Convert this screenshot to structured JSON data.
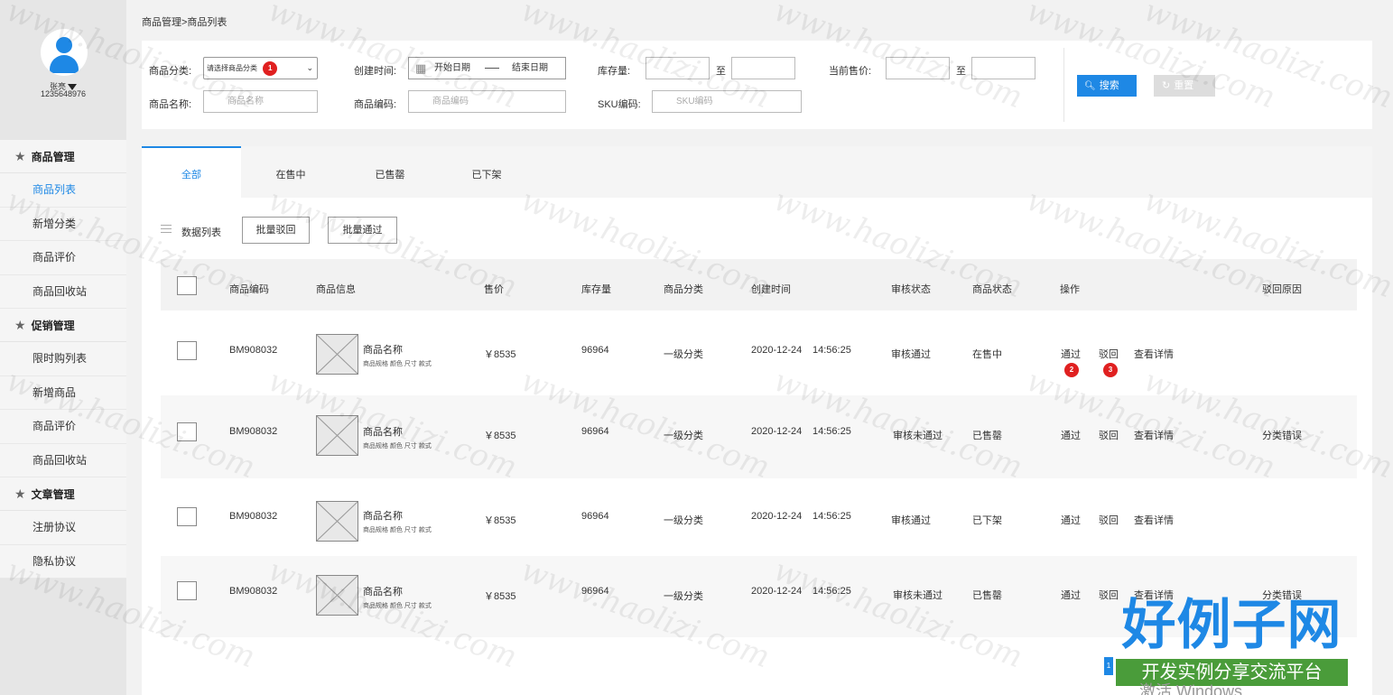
{
  "sidebar": {
    "user_name": "张亮",
    "user_id": "1235648976",
    "groups": [
      {
        "title": "商品管理",
        "items": [
          "商品列表",
          "新增分类",
          "商品评价",
          "商品回收站"
        ]
      },
      {
        "title": "促销管理",
        "items": [
          "限时购列表",
          "新增商品",
          "商品评价",
          "商品回收站"
        ]
      },
      {
        "title": "文章管理",
        "items": [
          "注册协议",
          "隐私协议"
        ]
      }
    ]
  },
  "breadcrumb": "商品管理>商品列表",
  "filters": {
    "category_label": "商品分类:",
    "category_value": "请选择商品分类",
    "category_badge": "1",
    "created_label": "创建时间:",
    "start_date": "开始日期",
    "end_date": "结束日期",
    "stock_label": "库存量:",
    "to": "至",
    "price_label": "当前售价:",
    "name_label": "商品名称:",
    "name_placeholder": "商品名称",
    "code_label": "商品编码:",
    "code_placeholder": "商品编码",
    "sku_label": "SKU编码:",
    "sku_placeholder": "SKU编码",
    "search_btn": "搜索",
    "reset_btn": "重置"
  },
  "tabs": [
    "全部",
    "在售中",
    "已售罄",
    "已下架"
  ],
  "list_title": "数据列表",
  "batch_reject": "批量驳回",
  "batch_pass": "批量通过",
  "columns": [
    "商品编码",
    "商品信息",
    "售价",
    "库存量",
    "商品分类",
    "创建时间",
    "审核状态",
    "商品状态",
    "操作",
    "驳回原因"
  ],
  "rows": [
    {
      "code": "BM908032",
      "name": "商品名称",
      "spec": "商品规格 颜色 尺寸 款式",
      "price": "￥8535",
      "stock": "96964",
      "category": "一级分类",
      "date": "2020-12-24",
      "time": "14:56:25",
      "audit": "审核通过",
      "status": "在售中",
      "reason": ""
    },
    {
      "code": "BM908032",
      "name": "商品名称",
      "spec": "商品规格 颜色 尺寸 款式",
      "price": "￥8535",
      "stock": "96964",
      "category": "一级分类",
      "date": "2020-12-24",
      "time": "14:56:25",
      "audit": "审核未通过",
      "status": "已售罄",
      "reason": "分类错误"
    },
    {
      "code": "BM908032",
      "name": "商品名称",
      "spec": "商品规格 颜色 尺寸 款式",
      "price": "￥8535",
      "stock": "96964",
      "category": "一级分类",
      "date": "2020-12-24",
      "time": "14:56:25",
      "audit": "审核通过",
      "status": "已下架",
      "reason": ""
    },
    {
      "code": "BM908032",
      "name": "商品名称",
      "spec": "商品规格 颜色 尺寸 款式",
      "price": "￥8535",
      "stock": "96964",
      "category": "一级分类",
      "date": "2020-12-24",
      "time": "14:56:25",
      "audit": "审核未通过",
      "status": "已售罄",
      "reason": "分类错误"
    }
  ],
  "ops": {
    "pass": "通过",
    "reject": "驳回",
    "detail": "查看详情",
    "badge_pass": "2",
    "badge_reject": "3"
  },
  "watermark": "www.haolizi.com",
  "logo_big": "好例子网",
  "logo_sub": "开发实例分享交流平台",
  "win_text": "激活 Windows",
  "pager_current": "1",
  "accent": "#1e88e5"
}
